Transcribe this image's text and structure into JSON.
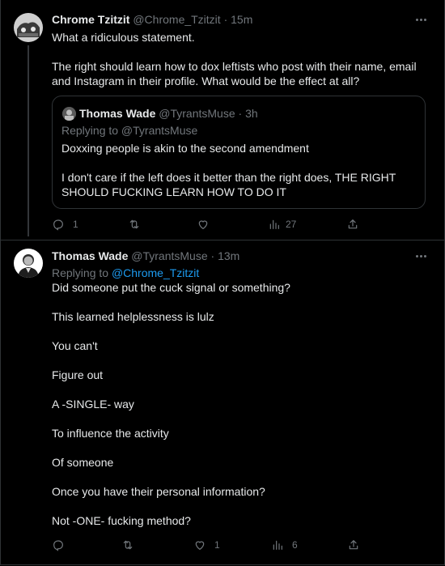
{
  "tweet1": {
    "author_name": "Chrome Tzitzit",
    "author_handle": "@Chrome_Tzitzit",
    "time": " · 15m",
    "paragraphs": [
      "What a ridiculous statement.",
      "The right should learn how to dox leftists who post with their name, email and Instagram in their profile. What would be the effect at all?"
    ],
    "quote": {
      "author_name": "Thomas Wade",
      "author_handle": "@TyrantsMuse",
      "time": " · 3h",
      "replying_to": "Replying to @TyrantsMuse",
      "paragraphs": [
        "Doxxing people is akin to the second amendment",
        "I don't care if the left does it better than the right does, THE RIGHT SHOULD FUCKING LEARN HOW TO DO IT"
      ]
    },
    "actions": {
      "replies": "1",
      "retweets": "",
      "likes": "",
      "views": "27"
    }
  },
  "tweet2": {
    "author_name": "Thomas Wade",
    "author_handle": "@TyrantsMuse",
    "time": " · 13m",
    "replying_prefix": "Replying to ",
    "replying_handle": "@Chrome_Tzitzit",
    "paragraphs": [
      "Did someone put the cuck signal or something?",
      "This learned helplessness is lulz",
      "You can't",
      "Figure out",
      "A -SINGLE- way",
      "To influence the activity",
      "Of someone",
      "Once you have their personal information?",
      "Not -ONE- fucking method?"
    ],
    "actions": {
      "replies": "",
      "retweets": "",
      "likes": "1",
      "views": "6"
    }
  },
  "icons": {
    "reply": "reply-icon",
    "retweet": "retweet-icon",
    "like": "heart-icon",
    "views": "views-icon",
    "share": "share-icon",
    "more": "more-icon"
  },
  "colors": {
    "background": "#000000",
    "text": "#e7e9ea",
    "muted": "#71767b",
    "link": "#1d9bf0",
    "border": "#2f3336"
  }
}
